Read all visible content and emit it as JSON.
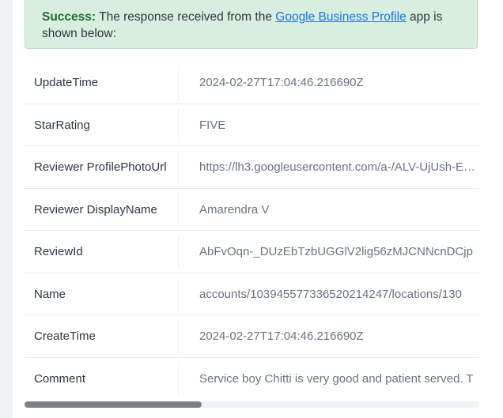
{
  "alert": {
    "success_label": "Success:",
    "text_before": "The response received from the",
    "link_text": "Google Business Profile",
    "text_after": "app is shown below:"
  },
  "rows": [
    {
      "key": "UpdateTime",
      "value": "2024-02-27T17:04:46.216690Z"
    },
    {
      "key": "StarRating",
      "value": "FIVE"
    },
    {
      "key": "Reviewer ProfilePhotoUrl",
      "value": "https://lh3.googleusercontent.com/a-/ALV-UjUsh-E…"
    },
    {
      "key": "Reviewer DisplayName",
      "value": "Amarendra V"
    },
    {
      "key": "ReviewId",
      "value": "AbFvOqn-_DUzEbTzbUGGlV2lig56zMJCNNcnDCjp"
    },
    {
      "key": "Name",
      "value": "accounts/103945577336520214247/locations/130"
    },
    {
      "key": "CreateTime",
      "value": "2024-02-27T17:04:46.216690Z"
    },
    {
      "key": "Comment",
      "value": "Service boy Chitti is very good and patient served. T"
    }
  ],
  "scroll": {
    "fraction": 0.39
  }
}
